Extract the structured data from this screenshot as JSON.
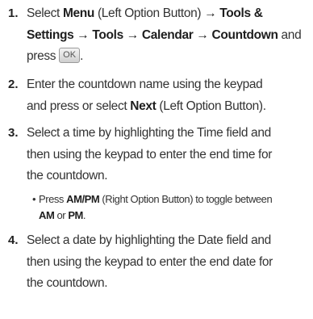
{
  "steps": [
    {
      "number": "1.",
      "lines": [
        [
          "Select ",
          "Menu",
          " (Left Option Button) ",
          "→ Tools &"
        ],
        [
          "Settings → Tools → Calendar → Countdown",
          " and"
        ],
        [
          "press ",
          "OK",
          "."
        ]
      ]
    },
    {
      "number": "2.",
      "lines": [
        [
          "Enter the countdown name using the keypad"
        ],
        [
          "and press or select ",
          "Next",
          " (Left Option Button)."
        ]
      ]
    },
    {
      "number": "3.",
      "lines": [
        [
          "Select a time by highlighting the Time field and"
        ],
        [
          "then using the keypad to enter the end time for"
        ],
        [
          "the countdown."
        ]
      ]
    },
    {
      "number": "4.",
      "lines": [
        [
          "Select a date by highlighting the Date field and"
        ],
        [
          "then using the keypad to enter the end date for"
        ],
        [
          "the countdown."
        ]
      ]
    }
  ],
  "bullet": {
    "symbol": "•",
    "line1": [
      "Press ",
      "AM/PM",
      " (Right Option Button) to toggle between"
    ],
    "line2": [
      "AM",
      " or ",
      "PM",
      "."
    ]
  }
}
